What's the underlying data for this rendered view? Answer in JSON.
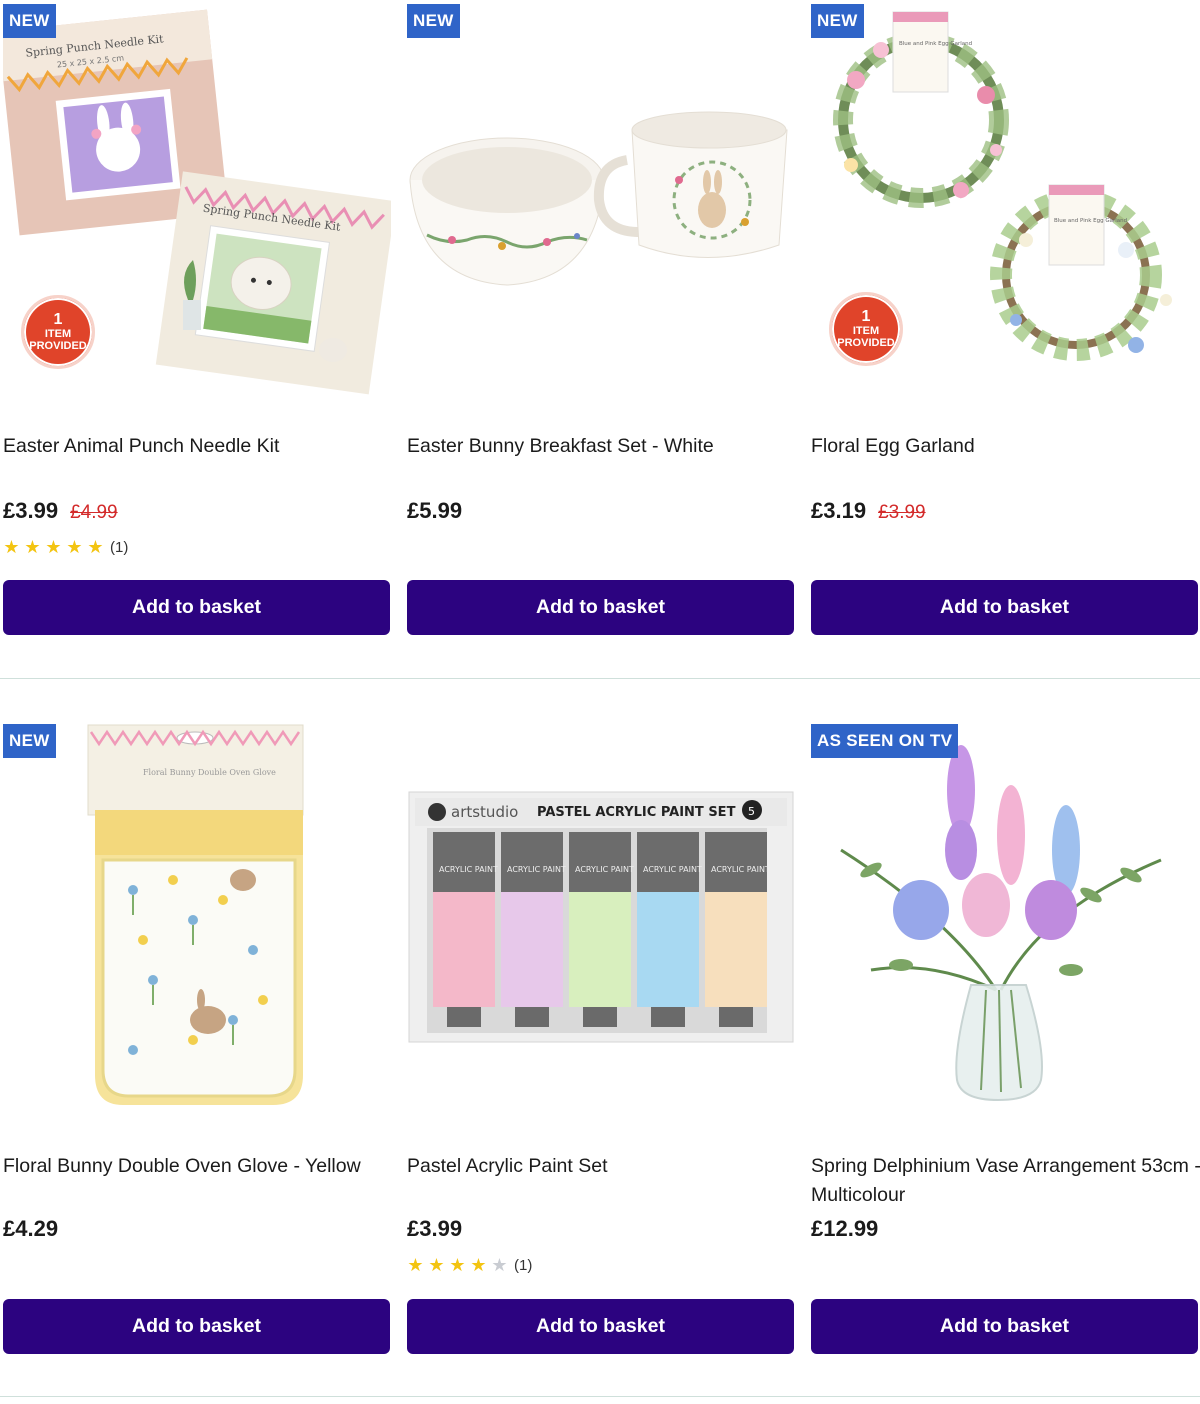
{
  "products": [
    {
      "badge": "NEW",
      "promo": {
        "num": "1",
        "line1": "ITEM",
        "line2": "PROVIDED"
      },
      "title": "Easter Animal Punch Needle Kit",
      "price": "£3.99",
      "was_price": "£4.99",
      "rating_count": "(1)",
      "stars": 5,
      "image": {
        "kit_label": "Spring Punch Needle Kit",
        "kit_size": "25 x 25 x 2.5 cm"
      },
      "button": "Add to basket"
    },
    {
      "badge": "NEW",
      "title": "Easter Bunny Breakfast Set - White",
      "price": "£5.99",
      "button": "Add to basket"
    },
    {
      "badge": "NEW",
      "promo": {
        "num": "1",
        "line1": "ITEM",
        "line2": "PROVIDED"
      },
      "title": "Floral Egg Garland",
      "price": "£3.19",
      "was_price": "£3.99",
      "image": {
        "tag_label": "Blue and Pink Egg Garland"
      },
      "button": "Add to basket"
    },
    {
      "badge": "NEW",
      "title": "Floral Bunny Double Oven Glove - Yellow",
      "price": "£4.29",
      "image": {
        "pack_label": "Floral Bunny Double Oven Glove"
      },
      "button": "Add to basket"
    },
    {
      "title": "Pastel Acrylic Paint Set",
      "price": "£3.99",
      "rating_count": "(1)",
      "stars": 4,
      "image": {
        "brand": "artstudio",
        "box_label": "PASTEL ACRYLIC PAINT SET",
        "tube_label": "ACRYLIC PAINT",
        "count": "5"
      },
      "button": "Add to basket"
    },
    {
      "badge": "AS SEEN ON TV",
      "title": "Spring Delphinium Vase Arrangement 53cm - Multicolour",
      "price": "£12.99",
      "button": "Add to basket"
    }
  ],
  "colors": {
    "badge": "#2f64c8",
    "button": "#2c0380",
    "was_price": "#d32a2a",
    "star": "#f3c411",
    "divider": "#cfe0db",
    "promo": "#e0442a"
  }
}
